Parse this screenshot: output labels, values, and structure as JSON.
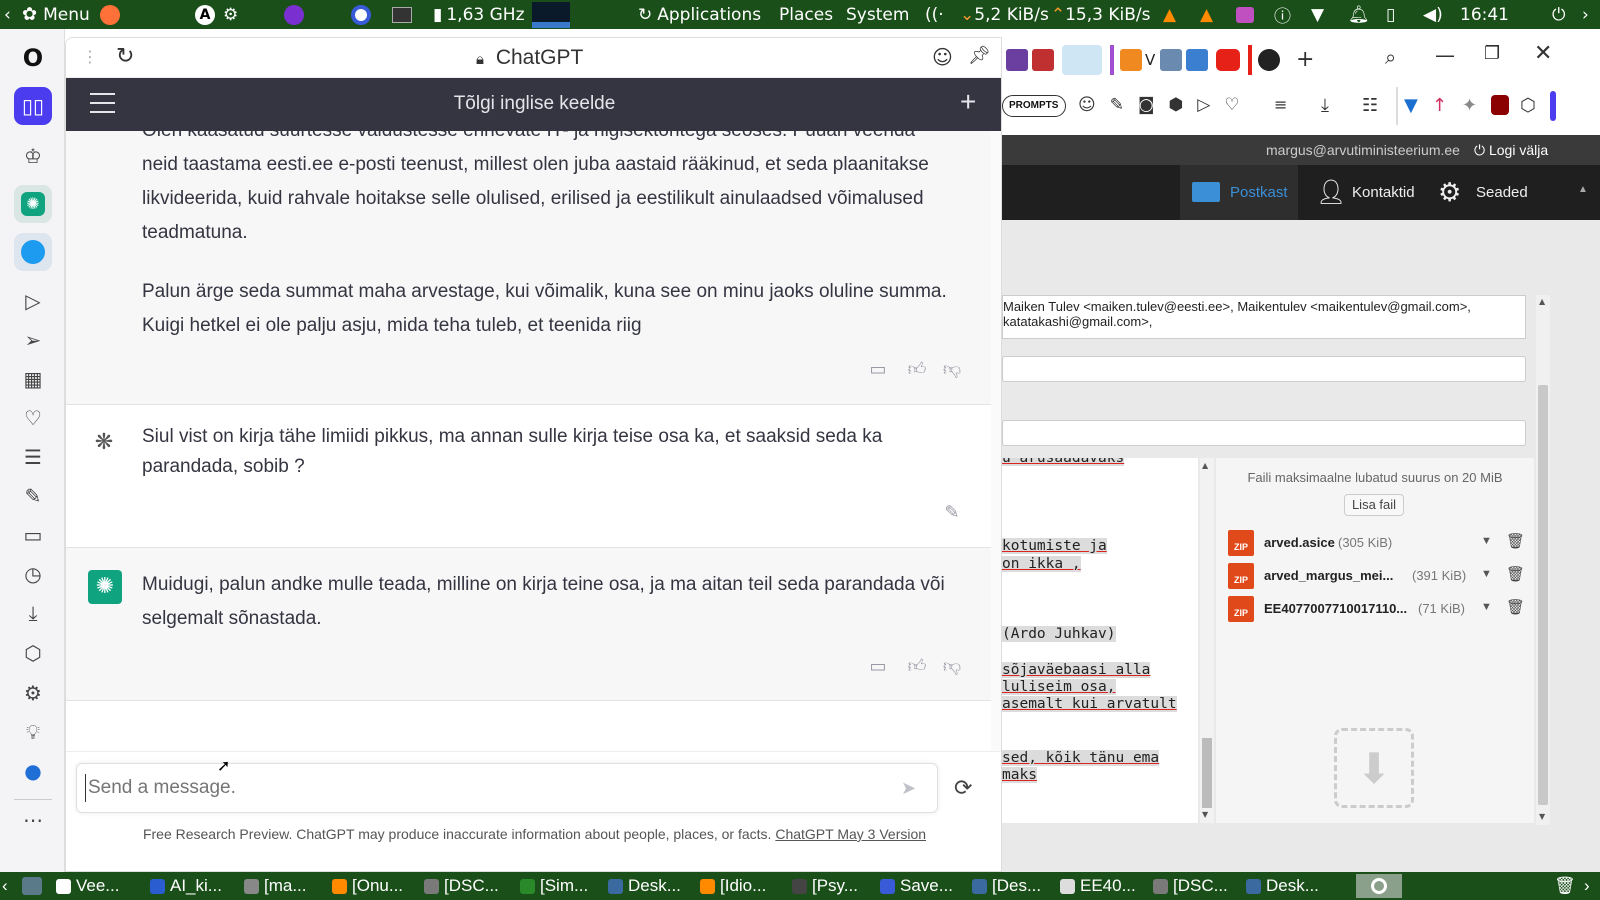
{
  "top_panel": {
    "menu_label": "Menu",
    "cpu_freq": "1,63 GHz",
    "applications": "Applications",
    "places": "Places",
    "system": "System",
    "net_down": "5,2 KiB/s",
    "net_up": "15,3 KiB/s",
    "clock": "16:41"
  },
  "chat": {
    "site_title": "ChatGPT",
    "header_title": "Tõlgi inglise keelde",
    "msg1_partial": "Olen kaasatud suurtesse valdustesse erinevate IT- ja riigisektoritega seoses. Püüan veenda",
    "msg1_p1_l2": "neid taastama eesti.ee e-posti teenust, millest olen juba aastaid rääkinud, et seda plaanitakse",
    "msg1_p1_l3": "likvideerida, kuid rahvale hoitakse selle olulised, erilised ja eestilikult ainulaadsed võimalused",
    "msg1_p1_l4": "teadmatuna.",
    "msg1_p2_l1": "Palun ärge seda summat maha arvestage, kui võimalik, kuna see on minu jaoks oluline summa.",
    "msg1_p2_l2": "Kuigi hetkel ei ole palju asju, mida teha tuleb, et teenida riig",
    "msg2_l1": "Siul vist on kirja tähe limiidi pikkus, ma annan sulle kirja teise osa ka, et saaksid seda ka",
    "msg2_l2": "parandada, sobib ?",
    "msg3_l1": "Muidugi, palun andke mulle teada, milline on kirja teine osa, ja ma aitan teil seda parandada või",
    "msg3_l2": "selgemalt sõnastada.",
    "input_placeholder": "Send a message.",
    "footer_text": "Free Research Preview. ChatGPT may produce inaccurate information about people, places, or facts.",
    "footer_link": "ChatGPT May 3 Version"
  },
  "mail": {
    "prompts_label": "PROMPTS",
    "user_email": "margus@arvutiministeerium.ee",
    "logout": "Logi välja",
    "nav_inbox": "Postkast",
    "nav_contacts": "Kontaktid",
    "nav_settings": "Seaded",
    "recipients_l1": "Maiken Tulev <maiken.tulev@eesti.ee>, Maikentulev <maikentulev@gmail.com>,",
    "recipients_l2": "katatakashi@gmail.com>,",
    "body_lines": [
      "u arusaadavaks",
      "kotumiste ja",
      "on ikka ,",
      "(Ardo Juhkav)",
      "sõjaväebaasi alla",
      "luliseim osa,",
      "asemalt kui arvatult",
      "sed, kõik tänu ema",
      "maks"
    ],
    "max_size": "Faili maksimaalne lubatud suurus on 20 MiB",
    "add_file": "Lisa fail",
    "attachments": [
      {
        "name": "arved.asice",
        "size": "(305 KiB)"
      },
      {
        "name": "arved_margus_mei...",
        "size": "(391 KiB)"
      },
      {
        "name": "EE4077007710017110...",
        "size": "(71 KiB)"
      }
    ],
    "zip_label": "ZIP"
  },
  "taskbar": {
    "items": [
      "Vee...",
      "AI_ki...",
      "[ma...",
      "[Onu...",
      "[DSC...",
      "[Sim...",
      "Desk...",
      "[Idio...",
      "[Psy...",
      "Save...",
      "[Des...",
      "EE40...",
      "[DSC...",
      "Desk..."
    ]
  },
  "colors": {
    "panel_green": "#1a4f1a",
    "chat_header": "#343541",
    "openai_green": "#10a37f",
    "mail_accent": "#3a8fd6"
  }
}
